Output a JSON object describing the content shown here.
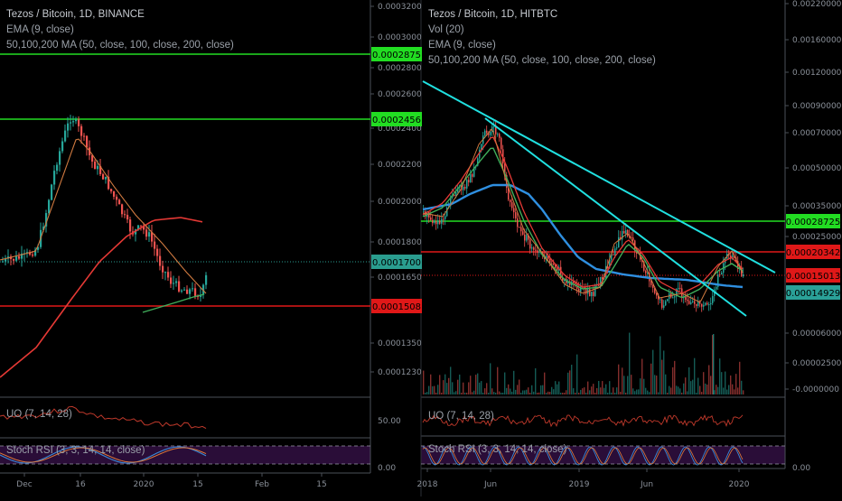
{
  "left_panel": {
    "legend": [
      "Tezos / Bitcoin, 1D, BINANCE",
      "EMA (9, close)",
      "50,100,200 MA (50, close, 100, close, 200, close)"
    ],
    "price_axis": [
      "0.0003200",
      "0.0003000",
      "0.0002800",
      "0.0002600",
      "0.0002400",
      "0.0002200",
      "0.0002000",
      "0.0001800",
      "0.0001650",
      "0.0001350",
      "0.0001230"
    ],
    "price_tags": [
      {
        "value": "0.0002875",
        "color": "#22dd22"
      },
      {
        "value": "0.0002456",
        "color": "#22dd22"
      },
      {
        "value": "0.0001700",
        "color": "#2a9d8f"
      },
      {
        "value": "0.0001508",
        "color": "#e01818"
      }
    ],
    "time_axis": [
      "Dec",
      "16",
      "2020",
      "15",
      "Feb",
      "15"
    ],
    "uo_label": "UO (7, 14, 28)",
    "uo_axis": "50.00",
    "stoch_label": "Stoch RSI (3, 3, 14, 14, close)",
    "stoch_axis": "0.00"
  },
  "right_panel": {
    "legend": [
      "Tezos / Bitcoin, 1D, HITBTC",
      "Vol (20)",
      "EMA (9, close)",
      "50,100,200 MA (50, close, 100, close, 200, close)"
    ],
    "price_axis": [
      "0.00220000",
      "0.00160000",
      "0.00120000",
      "0.00090000",
      "0.00070000",
      "0.00050000",
      "0.00035000",
      "0.00025000",
      "0.00006000",
      "0.00002500",
      "-0.0000000"
    ],
    "price_tags": [
      {
        "value": "0.00028725",
        "color": "#22dd22"
      },
      {
        "value": "0.00020342",
        "color": "#e01818"
      },
      {
        "value": "0.00015013",
        "color": "#e01818"
      },
      {
        "value": "0.00014929",
        "color": "#2aa198"
      }
    ],
    "time_axis": [
      "2018",
      "Jun",
      "2019",
      "Jun",
      "2020"
    ],
    "uo_label": "UO (7, 14, 28)",
    "stoch_label": "Stoch RSI (3, 3, 14, 14, close)",
    "stoch_axis": "0.00"
  },
  "colors": {
    "up": "#26a69a",
    "down": "#ef5350",
    "ma_red": "#e53935",
    "ma_blue": "#2f8fe0",
    "ma_green": "#3fae5a",
    "ema": "#d07a40",
    "trend": "#20e0e0",
    "hline_green": "#22dd22",
    "hline_red": "#e01818"
  },
  "chart_data": [
    {
      "type": "line",
      "title": "Tezos / Bitcoin, 1D, BINANCE",
      "x": [
        "Dec",
        "16",
        "2020",
        "15"
      ],
      "series": [
        {
          "name": "EMA (9, close)",
          "values": [
            0.00017,
            0.000258,
            0.000196,
            0.000163
          ]
        }
      ],
      "horizontal_levels": [
        0.0002875,
        0.0002456,
        0.00017,
        0.0001508
      ],
      "ylim": [
        0.000112,
        0.000322
      ]
    },
    {
      "type": "line",
      "title": "Tezos / Bitcoin, 1D, HITBTC",
      "x": [
        "2018",
        "Jun",
        "2019",
        "Jun",
        "2020"
      ],
      "series": [
        {
          "name": "EMA (9, close)",
          "values": [
            0.0004,
            0.00075,
            0.00021,
            0.00016,
            0.00015
          ]
        }
      ],
      "horizontal_levels": [
        0.00028725,
        0.00020342,
        0.00015013,
        0.00014929
      ],
      "ylim": [
        -1e-07,
        0.0022
      ]
    }
  ]
}
